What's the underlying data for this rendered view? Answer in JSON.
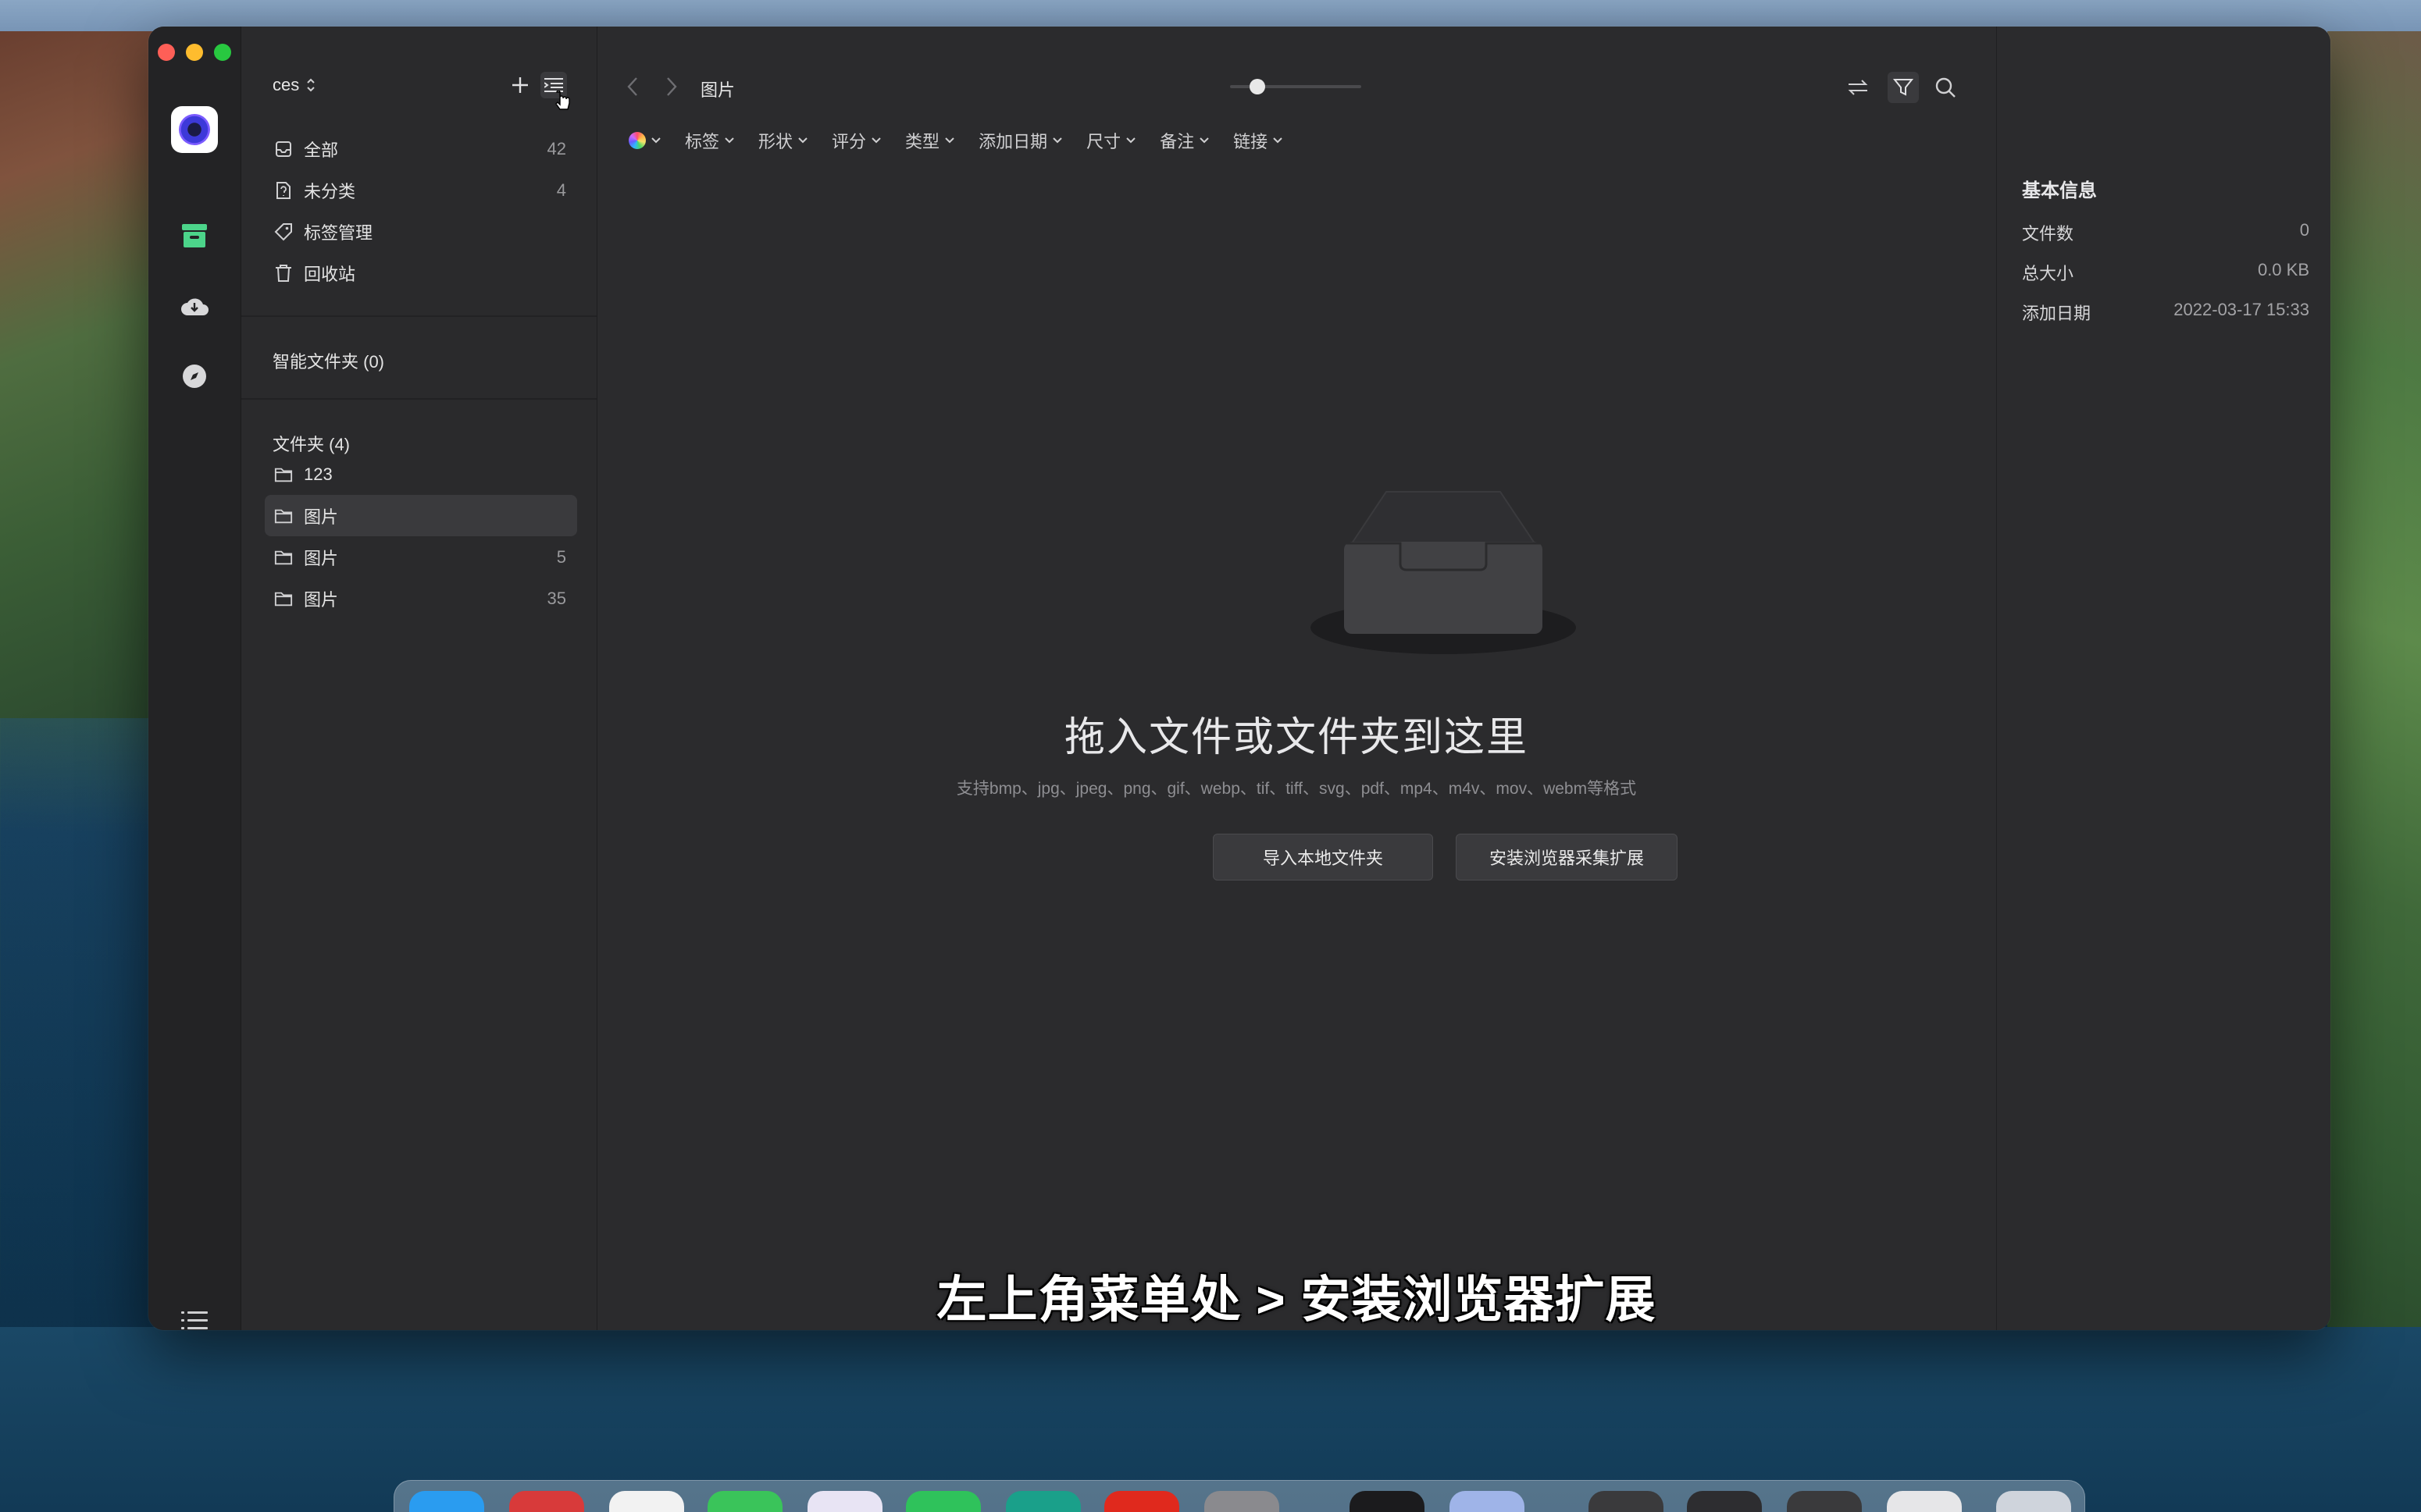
{
  "library": {
    "name": "ces"
  },
  "nav": {
    "items": [
      {
        "label": "全部",
        "count": "42",
        "icon": "inbox-icon"
      },
      {
        "label": "未分类",
        "count": "4",
        "icon": "file-question-icon"
      },
      {
        "label": "标签管理",
        "count": "",
        "icon": "tag-icon"
      },
      {
        "label": "回收站",
        "count": "",
        "icon": "trash-icon"
      }
    ]
  },
  "smart_folders": {
    "title": "智能文件夹 (0)"
  },
  "folders": {
    "title": "文件夹 (4)",
    "items": [
      {
        "label": "123",
        "count": ""
      },
      {
        "label": "图片",
        "count": ""
      },
      {
        "label": "图片",
        "count": "5"
      },
      {
        "label": "图片",
        "count": "35"
      }
    ],
    "selected_index": 1
  },
  "toolbar": {
    "breadcrumb": "图片",
    "zoom_level": 0.17
  },
  "filters": [
    "标签",
    "形状",
    "评分",
    "类型",
    "添加日期",
    "尺寸",
    "备注",
    "链接"
  ],
  "empty_state": {
    "title": "拖入文件或文件夹到这里",
    "subtitle": "支持bmp、jpg、jpeg、png、gif、webp、tif、tiff、svg、pdf、mp4、m4v、mov、webm等格式",
    "import_button": "导入本地文件夹",
    "extension_button": "安装浏览器采集扩展"
  },
  "caption": "左上角菜单处 > 安装浏览器扩展",
  "inspector": {
    "title": "基本信息",
    "rows": [
      {
        "key": "文件数",
        "value": "0"
      },
      {
        "key": "总大小",
        "value": "0.0 KB"
      },
      {
        "key": "添加日期",
        "value": "2022-03-17 15:33"
      }
    ]
  },
  "colors": {
    "accent_green": "#4cd48a",
    "window_bg": "#2b2b2d"
  }
}
